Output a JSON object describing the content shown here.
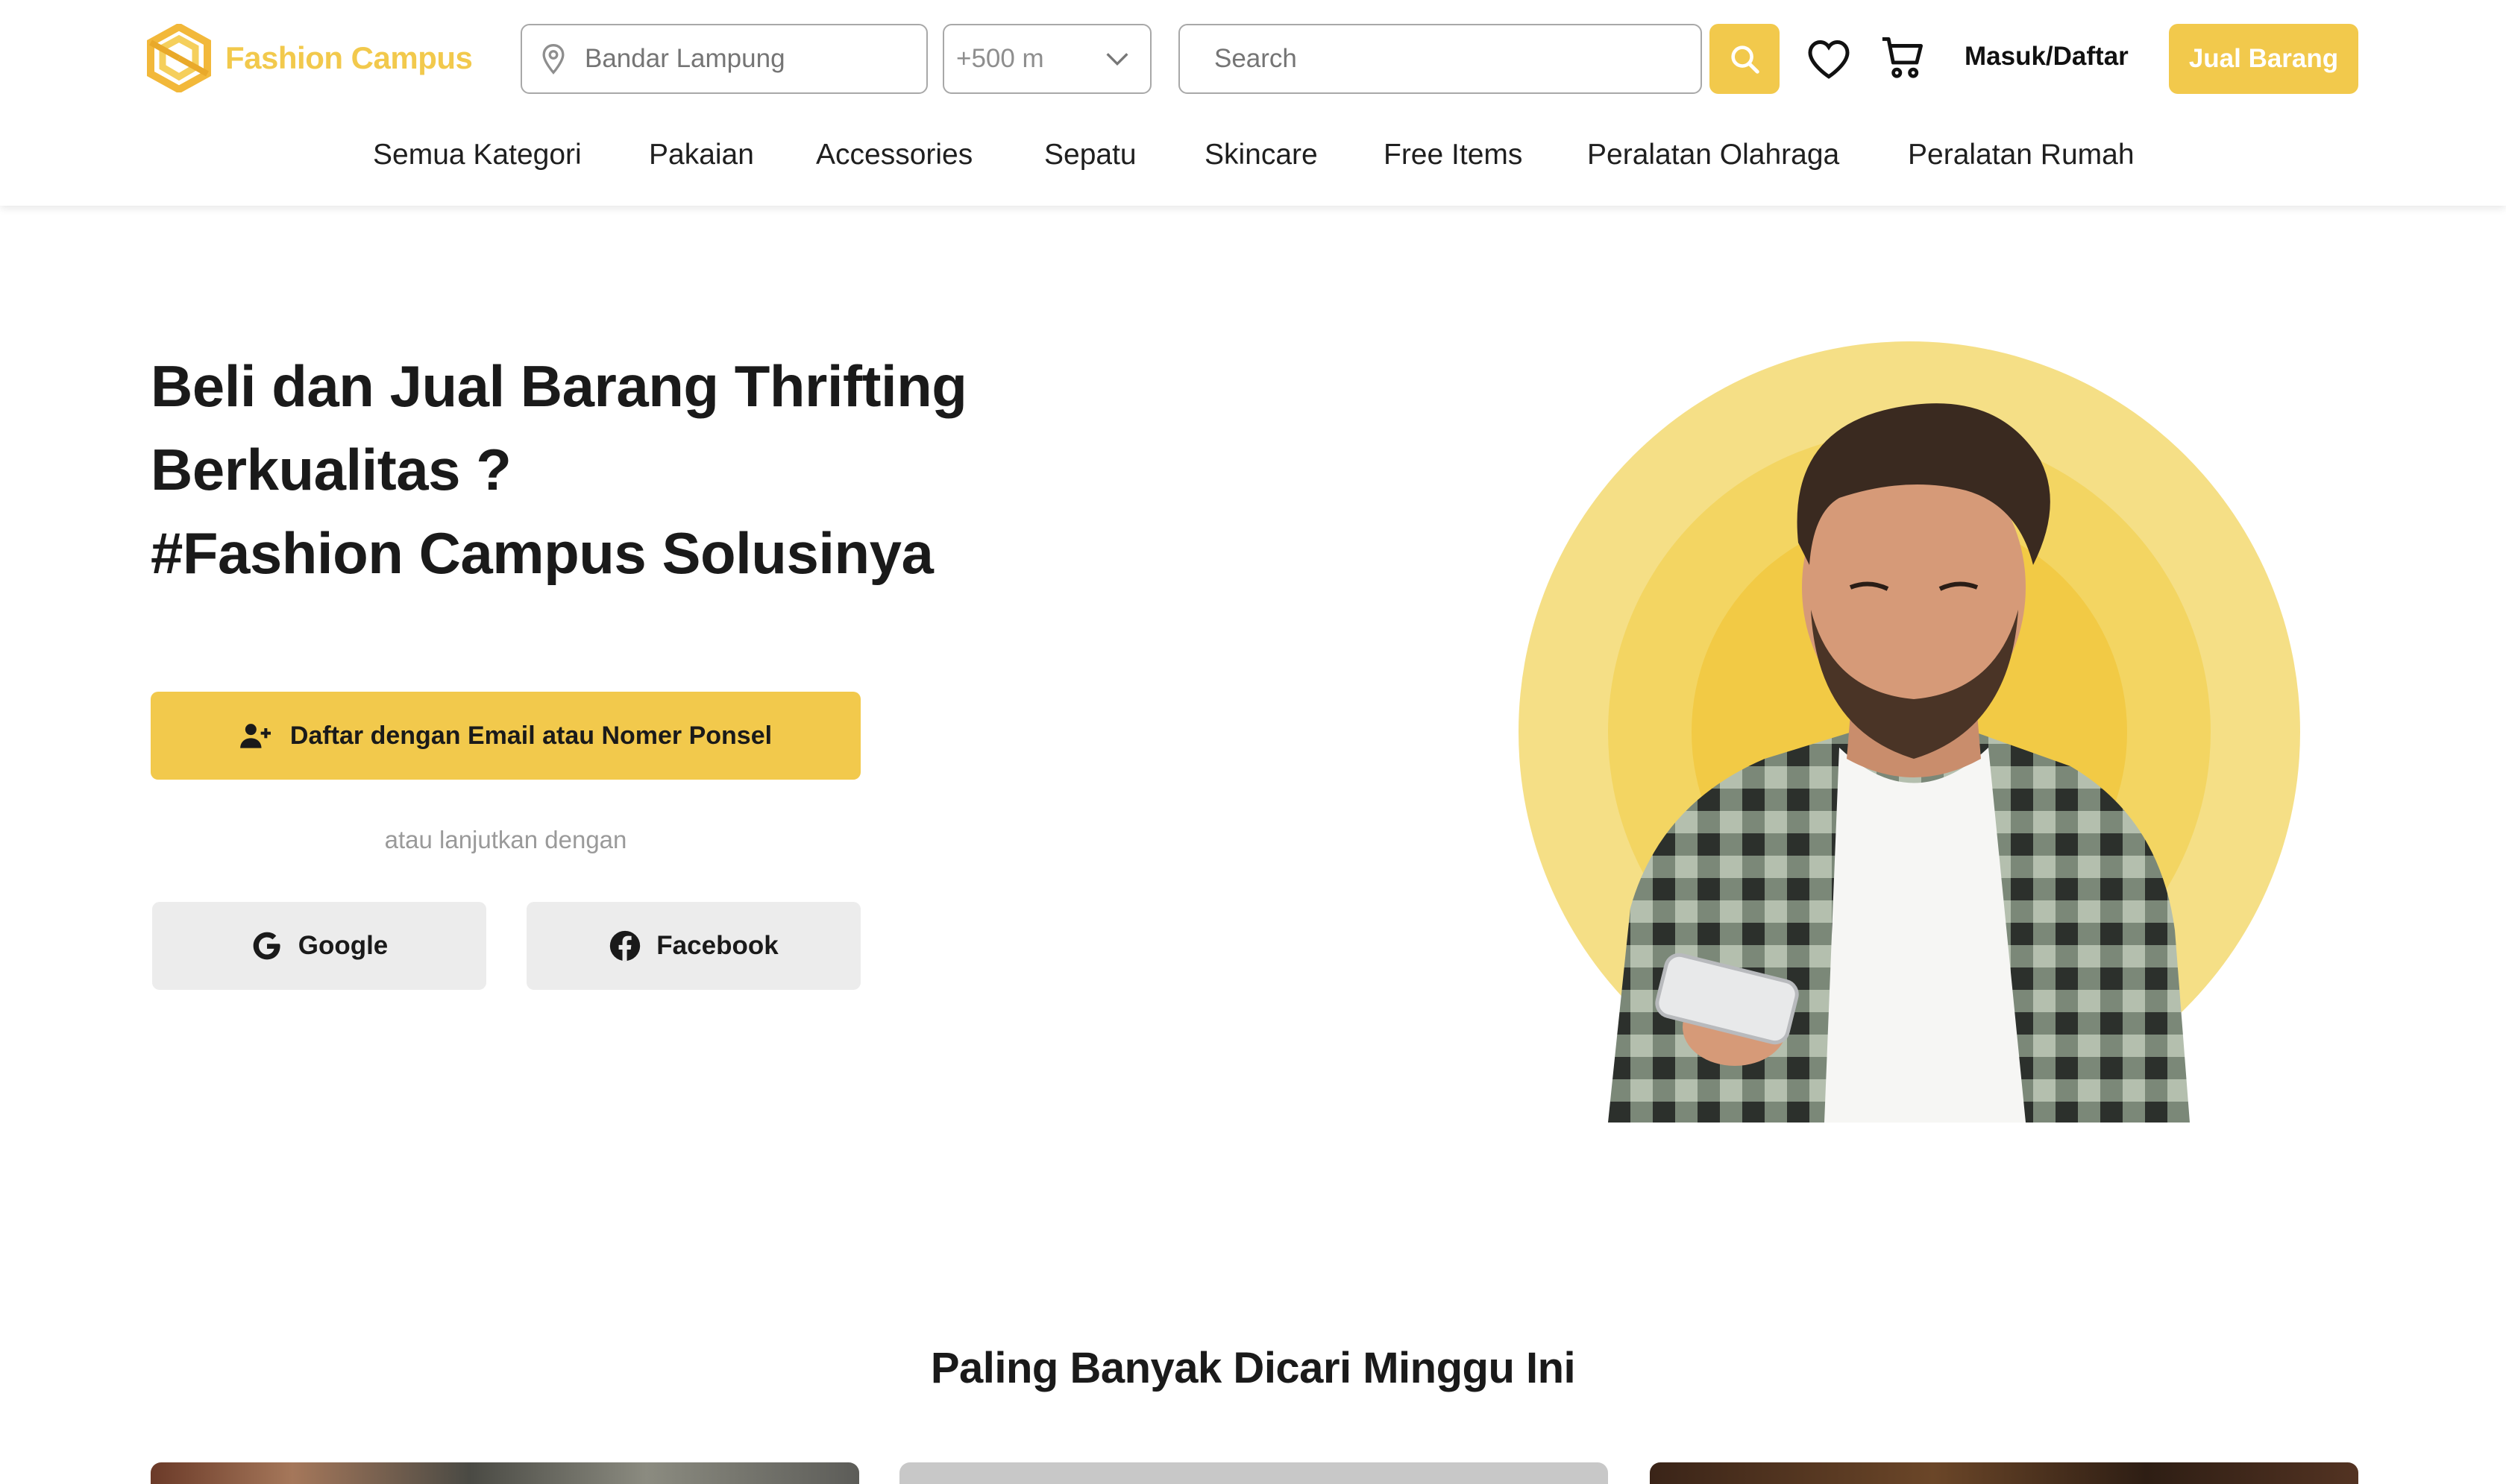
{
  "brand": {
    "name": "Fashion Campus",
    "accent": "#f2c94c",
    "icon": "hexagon-logo-icon"
  },
  "header": {
    "location_placeholder": "Bandar Lampung",
    "range_value": "+500 m",
    "search_placeholder": "Search",
    "login_label": "Masuk/Daftar",
    "sell_label": "Jual Barang",
    "icons": [
      "location-pin-icon",
      "chevron-down-icon",
      "search-icon",
      "heart-icon",
      "cart-icon"
    ]
  },
  "nav": {
    "items": [
      {
        "label": "Semua Kategori"
      },
      {
        "label": "Pakaian"
      },
      {
        "label": "Accessories"
      },
      {
        "label": "Sepatu"
      },
      {
        "label": "Skincare"
      },
      {
        "label": "Free Items"
      },
      {
        "label": "Peralatan Olahraga"
      },
      {
        "label": "Peralatan Rumah"
      }
    ]
  },
  "hero": {
    "title_lines": [
      "Beli dan Jual Barang Thrifting",
      "Berkualitas ?",
      "#Fashion Campus Solusinya"
    ],
    "email_button": "Daftar dengan Email atau Nomer Ponsel",
    "or_text": "atau lanjutkan dengan",
    "google_button": "Google",
    "facebook_button": "Facebook"
  },
  "section": {
    "title": "Paling Banyak Dicari Minggu Ini"
  }
}
